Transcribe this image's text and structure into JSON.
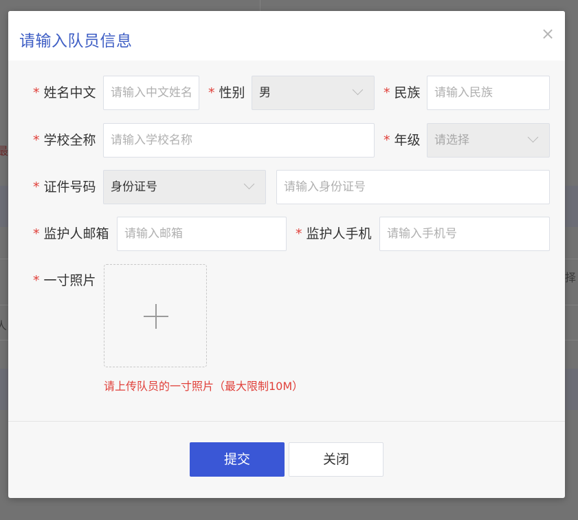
{
  "background": {
    "fragments": [
      "最",
      "择",
      "人"
    ]
  },
  "dialog": {
    "title": "请输入队员信息",
    "close_symbol": "×",
    "required_mark": "*",
    "fields": {
      "chinese_name": {
        "label": "姓名中文",
        "placeholder": "请输入中文姓名",
        "value": ""
      },
      "gender": {
        "label": "性别",
        "value": "男"
      },
      "ethnicity": {
        "label": "民族",
        "placeholder": "请输入民族",
        "value": ""
      },
      "school": {
        "label": "学校全称",
        "placeholder": "请输入学校名称",
        "value": ""
      },
      "grade": {
        "label": "年级",
        "placeholder": "请选择",
        "value": ""
      },
      "id_type": {
        "label": "证件号码",
        "value": "身份证号"
      },
      "id_number": {
        "placeholder": "请输入身份证号",
        "value": ""
      },
      "guardian_email": {
        "label": "监护人邮箱",
        "placeholder": "请输入邮箱",
        "value": ""
      },
      "guardian_phone": {
        "label": "监护人手机",
        "placeholder": "请输入手机号",
        "value": ""
      },
      "photo": {
        "label": "一寸照片",
        "hint": "请上传队员的一寸照片（最大限制10M）"
      }
    },
    "buttons": {
      "submit": "提交",
      "close": "关闭"
    }
  },
  "colors": {
    "title": "#3f5fc5",
    "required": "#e0403a",
    "primary": "#3a57d6",
    "overlay": "#727272"
  }
}
